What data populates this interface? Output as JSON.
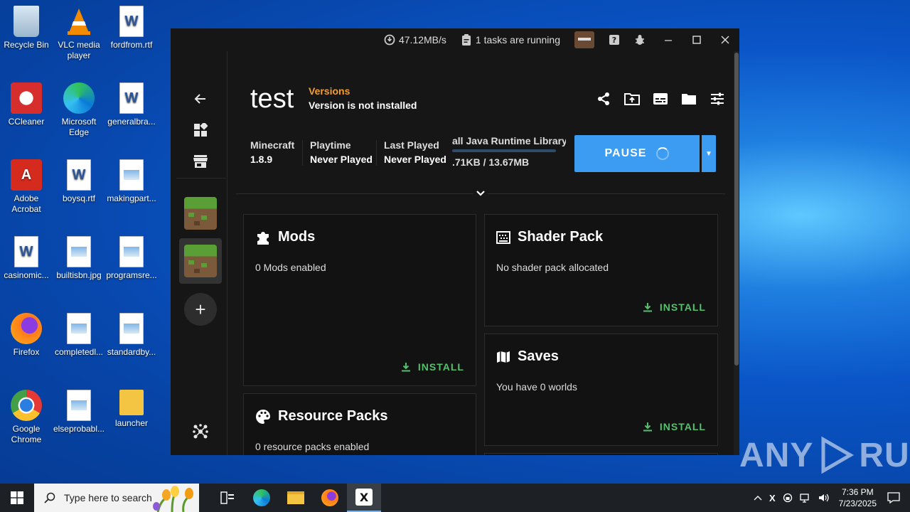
{
  "desktop": {
    "icons": [
      {
        "label": "Recycle Bin"
      },
      {
        "label": "VLC media player"
      },
      {
        "label": "fordfrom.rtf"
      },
      {
        "label": "CCleaner"
      },
      {
        "label": "Microsoft Edge"
      },
      {
        "label": "generalbra..."
      },
      {
        "label": "Adobe Acrobat"
      },
      {
        "label": "boysq.rtf"
      },
      {
        "label": "makingpart..."
      },
      {
        "label": "casinomic..."
      },
      {
        "label": "builtisbn.jpg"
      },
      {
        "label": "programsre..."
      },
      {
        "label": "Firefox"
      },
      {
        "label": "completedl..."
      },
      {
        "label": "standardby..."
      },
      {
        "label": "Google Chrome"
      },
      {
        "label": "elseprobabl..."
      },
      {
        "label": "launcher"
      }
    ]
  },
  "titlebar": {
    "speed": "47.12MB/s",
    "tasks": "1 tasks are running"
  },
  "instance": {
    "name": "test",
    "versions_label": "Versions",
    "version_status": "Version is not installed",
    "minecraft_label": "Minecraft",
    "minecraft_value": "1.8.9",
    "playtime_label": "Playtime",
    "playtime_value": "Never Played",
    "last_played_label": "Last Played",
    "last_played_value": "Never Played",
    "task_name": "all Java Runtime Library",
    "task_progress_text": ".71KB / 13.67MB",
    "task_progress": 0.0,
    "pause_label": "PAUSE"
  },
  "cards": {
    "mods": {
      "title": "Mods",
      "desc": "0 Mods enabled",
      "action": "INSTALL"
    },
    "shader": {
      "title": "Shader Pack",
      "desc": "No shader pack allocated",
      "action": "INSTALL"
    },
    "saves": {
      "title": "Saves",
      "desc": "You have 0 worlds",
      "action": "INSTALL"
    },
    "resource": {
      "title": "Resource Packs",
      "desc": "0 resource packs enabled"
    }
  },
  "taskbar": {
    "search_placeholder": "Type here to search",
    "time": "7:36 PM",
    "date": "7/23/2025"
  },
  "watermark": {
    "left": "ANY",
    "right": "RUN"
  },
  "colors": {
    "accent": "#3b9cf2",
    "install": "#54c06e",
    "versions": "#f59e2e"
  }
}
